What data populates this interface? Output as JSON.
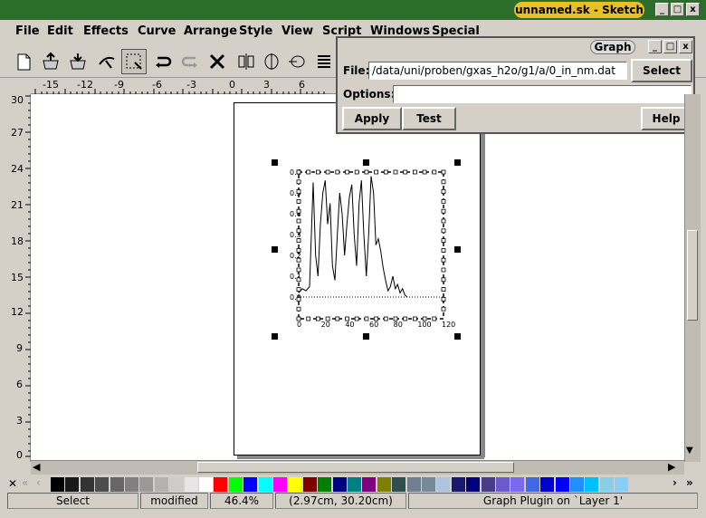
{
  "window": {
    "title": "unnamed.sk - Sketch",
    "min": "_",
    "max": "□",
    "close": "x"
  },
  "menu": [
    "File",
    "Edit",
    "Effects",
    "Curve",
    "Arrange",
    "Style",
    "View",
    "Script",
    "Windows",
    "Special"
  ],
  "ruler": {
    "h_ticks": [
      "-15",
      "-12",
      "-9",
      "-6",
      "-3",
      "0",
      "3",
      "6"
    ],
    "v_ticks": [
      "30",
      "27",
      "24",
      "21",
      "18",
      "15",
      "12",
      "9",
      "6",
      "3",
      "0"
    ]
  },
  "graph": {
    "y_ticks": [
      "0.6",
      "0.5",
      "0.4",
      "0.3",
      "0.2",
      "0.1",
      "0.0"
    ],
    "x_ticks": [
      "0",
      "20",
      "40",
      "60",
      "80",
      "100",
      "120"
    ],
    "curve": [
      [
        0,
        0.02
      ],
      [
        3,
        0.04
      ],
      [
        6,
        0.03
      ],
      [
        9,
        0.05
      ],
      [
        12,
        0.55
      ],
      [
        14,
        0.2
      ],
      [
        16,
        0.1
      ],
      [
        18,
        0.35
      ],
      [
        20,
        0.5
      ],
      [
        22,
        0.56
      ],
      [
        24,
        0.35
      ],
      [
        26,
        0.45
      ],
      [
        28,
        0.15
      ],
      [
        30,
        0.08
      ],
      [
        32,
        0.3
      ],
      [
        34,
        0.5
      ],
      [
        36,
        0.4
      ],
      [
        38,
        0.2
      ],
      [
        40,
        0.35
      ],
      [
        42,
        0.48
      ],
      [
        44,
        0.54
      ],
      [
        46,
        0.3
      ],
      [
        48,
        0.15
      ],
      [
        50,
        0.45
      ],
      [
        52,
        0.56
      ],
      [
        54,
        0.3
      ],
      [
        56,
        0.1
      ],
      [
        58,
        0.3
      ],
      [
        60,
        0.58
      ],
      [
        62,
        0.5
      ],
      [
        64,
        0.25
      ],
      [
        66,
        0.28
      ],
      [
        68,
        0.22
      ],
      [
        70,
        0.14
      ],
      [
        72,
        0.08
      ],
      [
        74,
        0.03
      ],
      [
        76,
        0.05
      ],
      [
        78,
        0.1
      ],
      [
        80,
        0.04
      ],
      [
        82,
        0.06
      ],
      [
        84,
        0.02
      ],
      [
        86,
        0.04
      ],
      [
        88,
        0.01
      ],
      [
        90,
        0.0
      ]
    ]
  },
  "dialog": {
    "title": "Graph",
    "file_label": "File:",
    "file_value": "/data/uni/proben/gxas_h2o/g1/a/0_in_nm.dat",
    "select_label": "Select",
    "options_label": "Options:",
    "options_value": "",
    "apply_label": "Apply",
    "test_label": "Test",
    "help_label": "Help"
  },
  "palette": {
    "colors": [
      "#000000",
      "#1a1a1a",
      "#333333",
      "#4d4d4d",
      "#666666",
      "#808080",
      "#999999",
      "#b3b3b3",
      "#cccccc",
      "#e6e6e6",
      "#ffffff",
      "#ff0000",
      "#00ff00",
      "#0000ff",
      "#00ffff",
      "#ff00ff",
      "#ffff00",
      "#800000",
      "#008000",
      "#000080",
      "#008080",
      "#800080",
      "#808000",
      "#2f4f4f",
      "#708090",
      "#778899",
      "#b0c4de",
      "#191970",
      "#000080",
      "#483d8b",
      "#6a5acd",
      "#7b68ee",
      "#4169e1",
      "#0000cd",
      "#0000ff",
      "#1e90ff",
      "#00bfff",
      "#87ceeb",
      "#87cefa"
    ]
  },
  "status": {
    "mode": "Select",
    "modified": "modified",
    "zoom": "46.4%",
    "coords": "(2.97cm, 30.20cm)",
    "info": "Graph Plugin on `Layer 1'"
  }
}
